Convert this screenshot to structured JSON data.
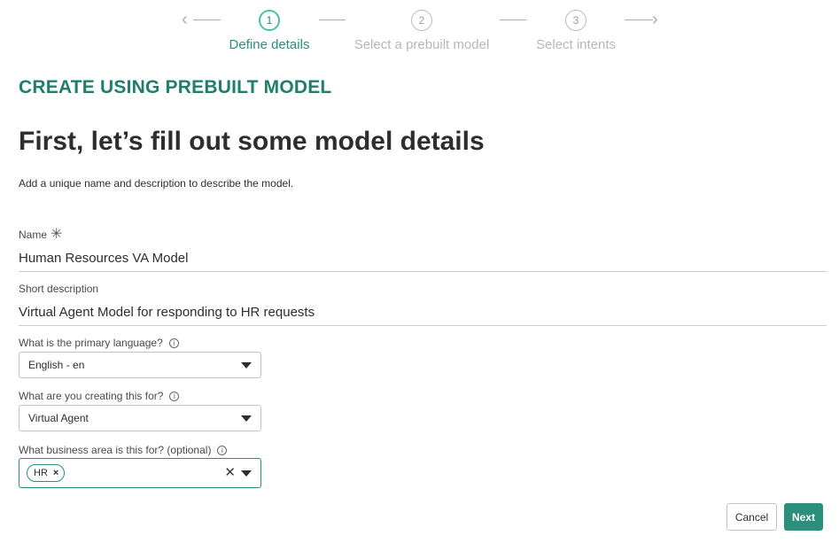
{
  "stepper": {
    "steps": [
      {
        "number": "1",
        "label": "Define details"
      },
      {
        "number": "2",
        "label": "Select a prebuilt model"
      },
      {
        "number": "3",
        "label": "Select intents"
      }
    ],
    "back_icon": "chevron-left-icon",
    "forward_icon": "chevron-right-icon"
  },
  "header": {
    "section_title": "CREATE USING PREBUILT MODEL",
    "page_title": "First, let’s fill out some model details",
    "subtitle": "Add a unique name and description to describe the model."
  },
  "form": {
    "name": {
      "label": "Name",
      "value": "Human Resources VA Model",
      "required_icon": "asterisk-icon"
    },
    "short_description": {
      "label": "Short description",
      "value": "Virtual Agent Model for responding to HR requests"
    },
    "language": {
      "label": "What is the primary language?",
      "value": "English - en"
    },
    "purpose": {
      "label": "What are you creating this for?",
      "value": "Virtual Agent"
    },
    "business_area": {
      "label": "What business area is this for? (optional)",
      "chips": [
        "HR"
      ]
    }
  },
  "info_glyph": "i",
  "remove_glyph": "×",
  "clear_glyph": "✕",
  "actions": {
    "cancel_label": "Cancel",
    "next_label": "Next"
  },
  "colors": {
    "accent": "#2a8f7b",
    "step_active": "#4dbfa8",
    "muted": "#b4b8bc"
  }
}
